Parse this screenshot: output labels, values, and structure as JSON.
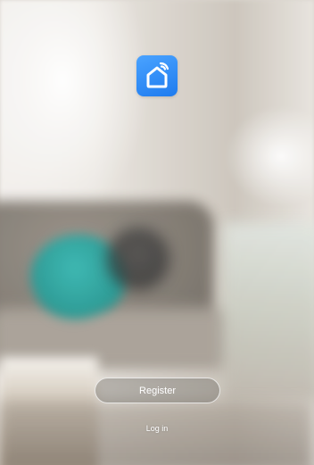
{
  "app": {
    "logo_icon": "smart-home-icon",
    "logo_color": "#2b8cf7"
  },
  "actions": {
    "register_label": "Register",
    "login_label": "Log in"
  }
}
